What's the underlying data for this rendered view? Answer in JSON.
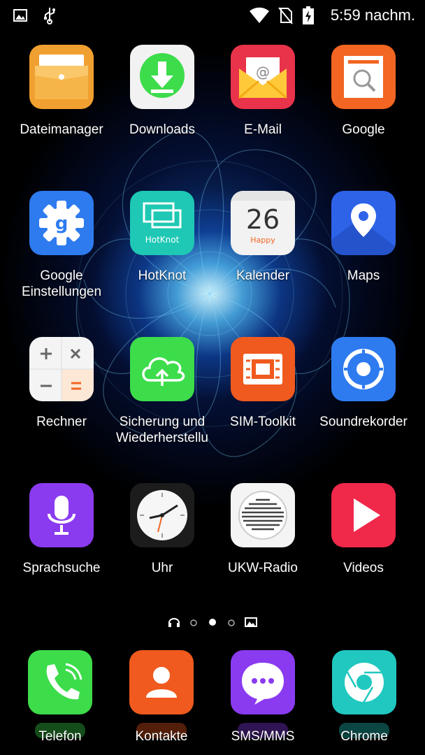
{
  "status_bar": {
    "time": "5:59 nachm.",
    "icons": [
      "image-notification-icon",
      "usb-icon",
      "wifi-icon",
      "no-sim-icon",
      "battery-charging-icon"
    ]
  },
  "apps": [
    {
      "label": "Dateimanager",
      "icon": "folder-icon",
      "color": "#F0A030"
    },
    {
      "label": "Downloads",
      "icon": "download-icon",
      "color": "#3DDC4B"
    },
    {
      "label": "E-Mail",
      "icon": "mail-icon",
      "color": "#E8334A"
    },
    {
      "label": "Google",
      "icon": "google-search-icon",
      "color": "#F26522"
    },
    {
      "label": "Google Einstellungen",
      "icon": "google-settings-icon",
      "color": "#2E7BF0"
    },
    {
      "label": "HotKnot",
      "icon": "hotknot-icon",
      "color": "#1EC8B4"
    },
    {
      "label": "Kalender",
      "icon": "calendar-icon",
      "color": "#F2F2F2",
      "day": "26",
      "sub": "Happy"
    },
    {
      "label": "Maps",
      "icon": "maps-icon",
      "color": "#2E63E8"
    },
    {
      "label": "Rechner",
      "icon": "calculator-icon",
      "color": "#F4F4F4"
    },
    {
      "label": "Sicherung und Wiederherstellu",
      "icon": "backup-cloud-icon",
      "color": "#3DDC4B"
    },
    {
      "label": "SIM-Toolkit",
      "icon": "sim-toolkit-icon",
      "color": "#F05A1E"
    },
    {
      "label": "Soundrekorder",
      "icon": "sound-recorder-icon",
      "color": "#2E7BF0"
    },
    {
      "label": "Sprachsuche",
      "icon": "microphone-icon",
      "color": "#8A3BF0"
    },
    {
      "label": "Uhr",
      "icon": "clock-icon",
      "color": "#1C1C1C"
    },
    {
      "label": "UKW-Radio",
      "icon": "radio-icon",
      "color": "#F4F4F4"
    },
    {
      "label": "Videos",
      "icon": "play-icon",
      "color": "#F0284A"
    }
  ],
  "dock": [
    {
      "label": "Telefon",
      "icon": "phone-icon",
      "color": "#3DDC4B"
    },
    {
      "label": "Kontakte",
      "icon": "contacts-icon",
      "color": "#F05A1E"
    },
    {
      "label": "SMS/MMS",
      "icon": "messages-icon",
      "color": "#8A3BF0"
    },
    {
      "label": "Chrome",
      "icon": "chrome-icon",
      "color": "#20C8C0"
    }
  ],
  "page_indicator": {
    "items": [
      "headphones-page-icon",
      "page-dot",
      "page-dot-active",
      "page-dot",
      "gallery-page-icon"
    ],
    "active_index": 2
  }
}
